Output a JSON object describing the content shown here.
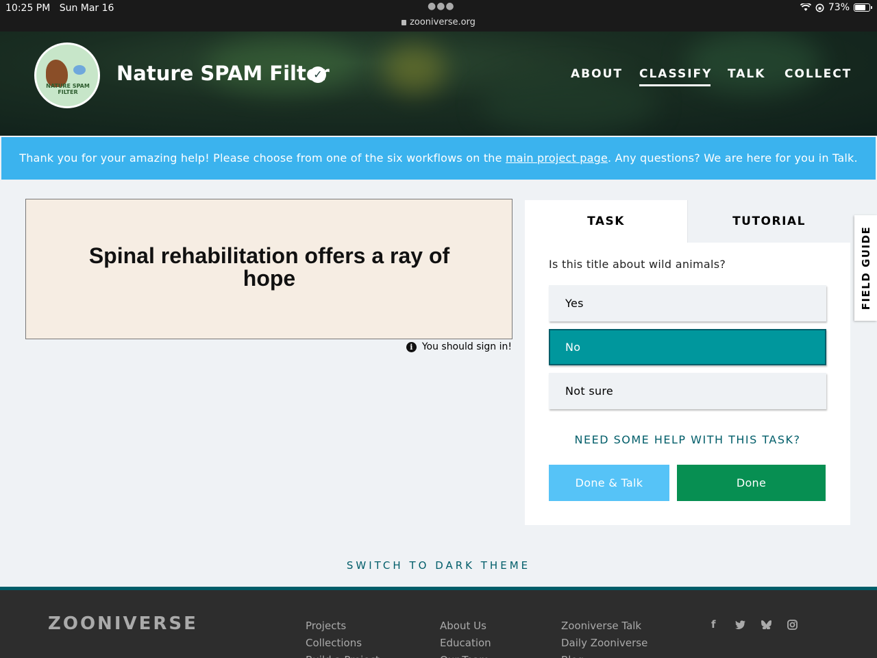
{
  "status_bar": {
    "time": "10:25 PM",
    "date": "Sun Mar 16",
    "url": "zooniverse.org",
    "battery": "73%",
    "battery_level": 0.73
  },
  "header": {
    "project_title": "Nature SPAM Filter",
    "logo_text": "NATURE SPAM FILTER",
    "verified_icon": "check-circle-icon",
    "nav": [
      "ABOUT",
      "CLASSIFY",
      "TALK",
      "COLLECT"
    ],
    "active_nav": "CLASSIFY"
  },
  "banner": {
    "text_before": "Thank you for your amazing help! Please choose from one of the six workflows on the ",
    "link_text": "main project page",
    "text_after": ". Any questions? We are here for you in Talk.",
    "color": "#3bb3ee"
  },
  "subject": {
    "text": "Spinal rehabilitation offers a ray of hope",
    "sign_in_notice": "You should sign in!"
  },
  "task_panel": {
    "tabs": [
      "TASK",
      "TUTORIAL"
    ],
    "question": "Is this title about wild animals?",
    "answers": [
      "Yes",
      "No",
      "Not sure"
    ],
    "selected_answer": "No",
    "help_link": "NEED SOME HELP WITH THIS TASK?",
    "done_talk_button": "Done & Talk",
    "done_button": "Done",
    "accent_color": "#00979d",
    "done_color": "#078f52"
  },
  "field_guide": "FIELD GUIDE",
  "theme_toggle": "SWITCH TO DARK THEME",
  "footer": {
    "logo": "ZOONIVERSE",
    "col1": [
      "Projects",
      "Collections",
      "Build a Project"
    ],
    "col2": [
      "About Us",
      "Education",
      "Our Team"
    ],
    "col3": [
      "Zooniverse Talk",
      "Daily Zooniverse",
      "Blog"
    ],
    "social_icons": [
      "facebook-icon",
      "twitter-icon",
      "bluesky-icon",
      "instagram-icon"
    ]
  }
}
